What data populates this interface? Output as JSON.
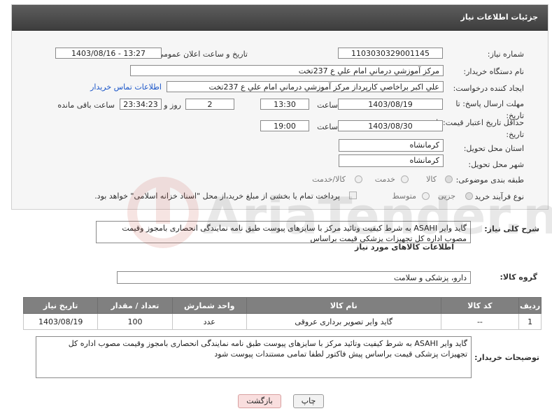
{
  "header": {
    "title": "جزئیات اطلاعات نیاز"
  },
  "form": {
    "need_number": {
      "label": "شماره نیاز:",
      "value": "1103030329001145"
    },
    "announce": {
      "label": "تاریخ و ساعت اعلان عمومی:",
      "value": "1403/08/16 - 13:27"
    },
    "buyer": {
      "label": "نام دستگاه خریدار:",
      "value": "مرکز آموزشي درماني امام علي ع 237تخت"
    },
    "creator": {
      "label": "ایجاد کننده درخواست:",
      "value": "علي اکبر براخاصي کارپرداز  مرکز آموزشي درماني امام علي ع 237تخت",
      "contact_link": "اطلاعات تماس خریدار"
    },
    "deadline": {
      "label": "مهلت ارسال پاسخ: تا تاریخ:",
      "date": "1403/08/19",
      "time_label": "ساعت",
      "time": "13:30",
      "days": "2",
      "days_label": "روز و",
      "remaining": "23:34:23",
      "remaining_label": "ساعت باقی مانده"
    },
    "validity": {
      "label": "حداقل تاریخ اعتبار قیمت: تا تاریخ:",
      "date": "1403/08/30",
      "time_label": "ساعت",
      "time": "19:00"
    },
    "province": {
      "label": "استان محل تحویل:",
      "value": "کرمانشاه"
    },
    "city": {
      "label": "شهر محل تحویل:",
      "value": "کرمانشاه"
    },
    "category": {
      "label": "طبقه بندی موضوعی:",
      "options": [
        "کالا",
        "خدمت",
        "کالا/خدمت"
      ]
    },
    "process": {
      "label": "نوع فرآیند خرید :",
      "options": [
        "جزیی",
        "متوسط"
      ],
      "payment_note": "پرداخت تمام یا بخشی از مبلغ خرید،از محل \"اسناد خزانه اسلامی\" خواهد بود."
    }
  },
  "summary": {
    "label": "شرح کلی نیاز:",
    "text": "گاید وایر ASAHI  به شرط کیفیت وتائید مرکز با سایزهای پیوست طبق نامه نمایندگی انحصاری بامجوز وقیمت مصوب اداره کل تجهیزات پزشکی قیمت براساس"
  },
  "goods": {
    "section_title": "اطلاعات کالاهای مورد نیاز",
    "group_label": "گروه کالا:",
    "group_value": "دارو، پزشکی و سلامت",
    "columns": [
      "ردیف",
      "کد کالا",
      "نام کالا",
      "واحد شمارش",
      "تعداد / مقدار",
      "تاریخ نیاز"
    ],
    "rows": [
      [
        "1",
        "--",
        "گاید وایر تصویر برداری عروقی",
        "عدد",
        "100",
        "1403/08/19"
      ]
    ]
  },
  "buyer_notes": {
    "label": "توضیحات خریدار:",
    "text": "گاید وایر ASAHI  به شرط کیفیت وتائید مرکز با سایزهای پیوست طبق نامه نمایندگی انحصاری بامجوز وقیمت مصوب اداره کل تجهیزات پزشکی قیمت براساس پیش فاکتور لطفا تمامی مستندات پیوست شود"
  },
  "buttons": {
    "print": "چاپ",
    "back": "بازگشت"
  },
  "watermark": {
    "text": "AriaTender.neT"
  },
  "colors": {
    "header_bg": "#4a4a4a",
    "table_header": "#808080",
    "link": "#1a55c8",
    "back_button": "#f9dede"
  }
}
